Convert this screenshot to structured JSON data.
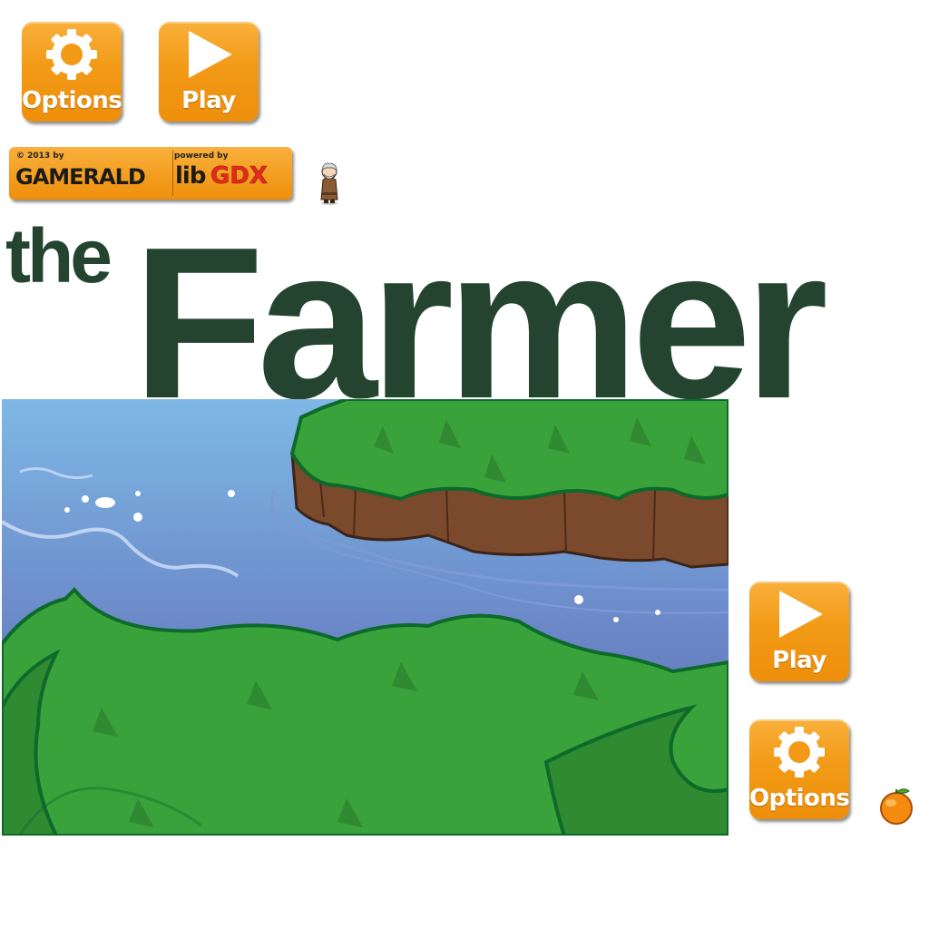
{
  "menu_top": {
    "options_label": "Options",
    "play_label": "Play"
  },
  "credits_badge": {
    "copyright_text": "© 2013 by",
    "studio_name": "GAMERALD",
    "powered_text": "powered by",
    "engine_name_part1": "lib",
    "engine_name_part2": "GDX"
  },
  "title": {
    "prefix": "the",
    "main": "Farmer"
  },
  "menu_side": {
    "play_label": "Play",
    "options_label": "Options"
  },
  "icons": {
    "options": "gear-icon",
    "play": "play-icon",
    "character": "farmer-sprite",
    "item": "orange-icon"
  },
  "colors": {
    "button_orange": "#f29a16",
    "title_green": "#254430",
    "grass_green": "#3a9a3a",
    "water_blue": "#6f8fc8"
  }
}
